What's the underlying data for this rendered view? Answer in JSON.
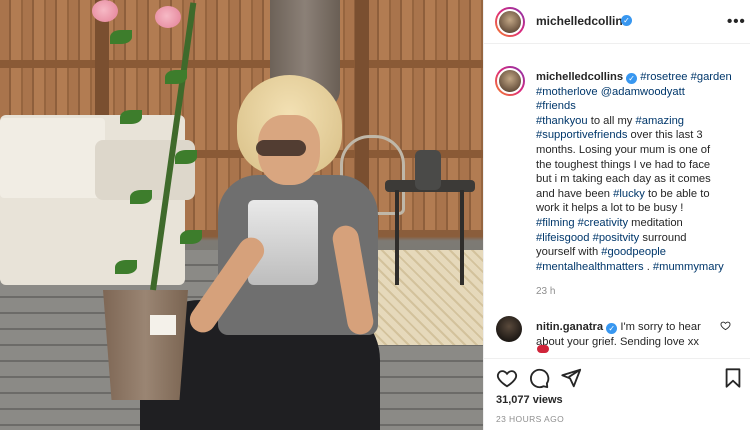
{
  "post": {
    "author": "michelledcollins",
    "caption_lines": [
      [
        "#rosetree",
        "#garden"
      ],
      [
        "#motherlove",
        "@adamwoodyatt"
      ],
      [
        "#friends"
      ],
      [
        "#thankyou",
        " to all my ",
        "#amazing"
      ],
      [
        "#supportivefriends",
        " over this last 3"
      ],
      [
        "months. Losing your mum is one of"
      ],
      [
        "the toughest things I ve had to face"
      ],
      [
        "but i m taking each day as it comes"
      ],
      [
        "and have been ",
        "#lucky",
        " to be able to"
      ],
      [
        "work it helps a lot to be busy !"
      ],
      [
        "#filming",
        " ",
        "#creativity",
        " meditation"
      ],
      [
        "#lifeisgood",
        " ",
        "#positvity",
        " surround"
      ],
      [
        "yourself with ",
        "#goodpeople"
      ],
      [
        "#mentalhealthmatters",
        " . ",
        "#mummymary"
      ]
    ],
    "caption_time": "23 h",
    "comment": {
      "author": "nitin.ganatra",
      "text": "I'm sorry to hear about your grief. Sending love xx"
    },
    "views": "31,077 views",
    "posted_ago": "23 HOURS AGO"
  },
  "icons": {
    "verified": "verified-badge-icon",
    "more": "more-options-icon",
    "like": "heart-icon",
    "comment": "comment-bubble-icon",
    "share": "paper-plane-icon",
    "save": "bookmark-icon"
  },
  "colors": {
    "hashtag": "#00376b",
    "verified": "#3897f0",
    "muted": "#8e8e8e",
    "text": "#262626"
  }
}
